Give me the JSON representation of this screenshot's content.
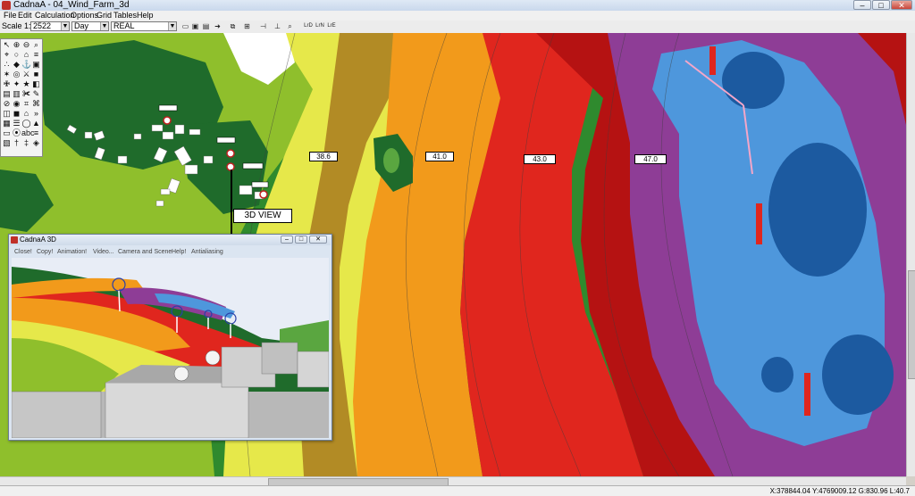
{
  "window": {
    "title": "CadnaA - 04_Wind_Farm_3d",
    "minimize": "–",
    "maximize": "□",
    "close": "✕"
  },
  "menu": [
    "File",
    "Edit",
    "Calculation",
    "Options",
    "Grid",
    "Tables",
    "Help"
  ],
  "toolbar": {
    "scale_label": "Scale 1:",
    "scale_value": "2522",
    "period_value": "Day",
    "mode_value": "REAL",
    "icons": [
      "open-icon",
      "save-icon",
      "print-icon",
      "arrow-icon",
      "copy-icon",
      "grid-icon",
      "level-icon"
    ],
    "small_labels": [
      "LrD",
      "LrN",
      "LrE"
    ]
  },
  "palette": {
    "icons": [
      "↖",
      "⊕",
      "⊖",
      "⌕",
      "⌖",
      "○",
      "⌂",
      "≡",
      "∴",
      "◆",
      "⚓",
      "▣",
      "✶",
      "◎",
      "⚔",
      "■",
      "✙",
      "✦",
      "★",
      "◧",
      "▤",
      "▥",
      "✀",
      "✎",
      "⊘",
      "◉",
      "⌗",
      "⌘",
      "◫",
      "◼",
      "⌂",
      "»",
      "▦",
      "☰",
      "◯",
      "▲",
      "▭",
      "⦿",
      "abc",
      "≡",
      "▧",
      "†",
      "‡",
      "◈"
    ]
  },
  "map": {
    "contour_labels": [
      "38.6",
      "41.0",
      "43.0",
      "47.0"
    ],
    "view_label": "3D VIEW",
    "colors": {
      "dark_green": "#1f6b2b",
      "green": "#2f8a2e",
      "light_green": "#8fbf2c",
      "yellow": "#e6e84a",
      "olive": "#a87a1e",
      "orange": "#f29a1b",
      "red": "#e0261e",
      "dark_red": "#b51212",
      "purple": "#8e3d96",
      "light_blue": "#4e97dc",
      "dark_blue": "#1c5aa0"
    }
  },
  "window3d": {
    "title": "CadnaA 3D",
    "menu": [
      "Close!",
      "Copy!",
      "Animation!",
      "Video...",
      "Camera and Scene",
      "Help!",
      "Antialiasing"
    ]
  },
  "statusbar": {
    "coords": "X:378844.04 Y:4769009.12 G:830.96 L:40.7"
  }
}
